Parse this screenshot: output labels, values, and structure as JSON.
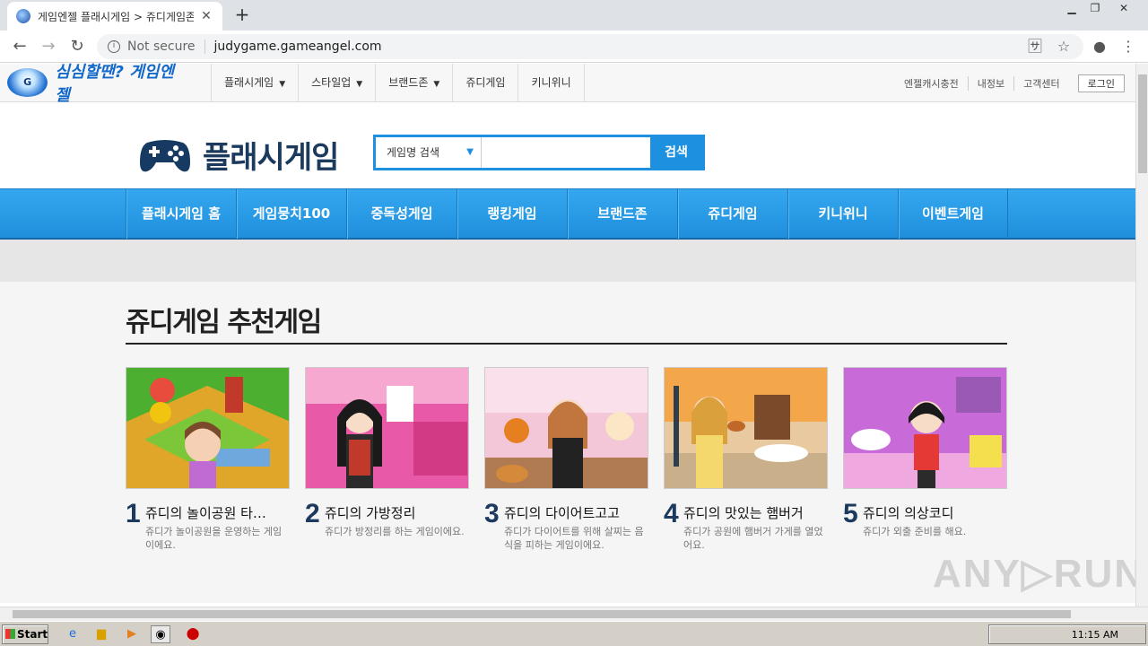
{
  "browser": {
    "tab_title": "게임엔젤 플래시게임 > 쥬디게임존",
    "not_secure": "Not secure",
    "url": "judygame.gameangel.com"
  },
  "site": {
    "logo_badge": "G",
    "logo_text": "심심할땐? 게임엔젤",
    "top_menu": [
      {
        "label": "플래시게임",
        "arrow": "▼"
      },
      {
        "label": "스타일업",
        "arrow": "▼"
      },
      {
        "label": "브랜드존",
        "arrow": "▼"
      },
      {
        "label": "쥬디게임",
        "arrow": ""
      },
      {
        "label": "키니위니",
        "arrow": ""
      }
    ],
    "top_links": [
      "엔젤캐시충전",
      "내정보",
      "고객센터"
    ],
    "login": "로그인",
    "header_title": "플래시게임",
    "search": {
      "select": "게임명 검색",
      "button": "검색",
      "placeholder": ""
    },
    "nav": [
      "플래시게임 홈",
      "게임뭉치100",
      "중독성게임",
      "랭킹게임",
      "브랜드존",
      "쥬디게임",
      "키니위니",
      "이벤트게임"
    ],
    "section_title": "쥬디게임 추천게임",
    "games": [
      {
        "num": "1",
        "title": "쥬디의 놀이공원 타…",
        "desc": "쥬디가 놀이공원을 운영하는 게임이에요."
      },
      {
        "num": "2",
        "title": "쥬디의 가방정리",
        "desc": "쥬디가 방정리를 하는 게임이에요."
      },
      {
        "num": "3",
        "title": "쥬디의 다이어트고고",
        "desc": "쥬디가 다이어트를 위해 살찌는 음식을 피하는 게임이에요."
      },
      {
        "num": "4",
        "title": "쥬디의 맛있는 햄버거",
        "desc": "쥬디가 공원에 햄버거 가게를 열었어요."
      },
      {
        "num": "5",
        "title": "쥬디의 의상코디",
        "desc": "쥬디가 외출 준비를 해요."
      }
    ],
    "watermark": "ANY▷RUN"
  },
  "taskbar": {
    "start": "Start",
    "clock": "11:15 AM"
  }
}
